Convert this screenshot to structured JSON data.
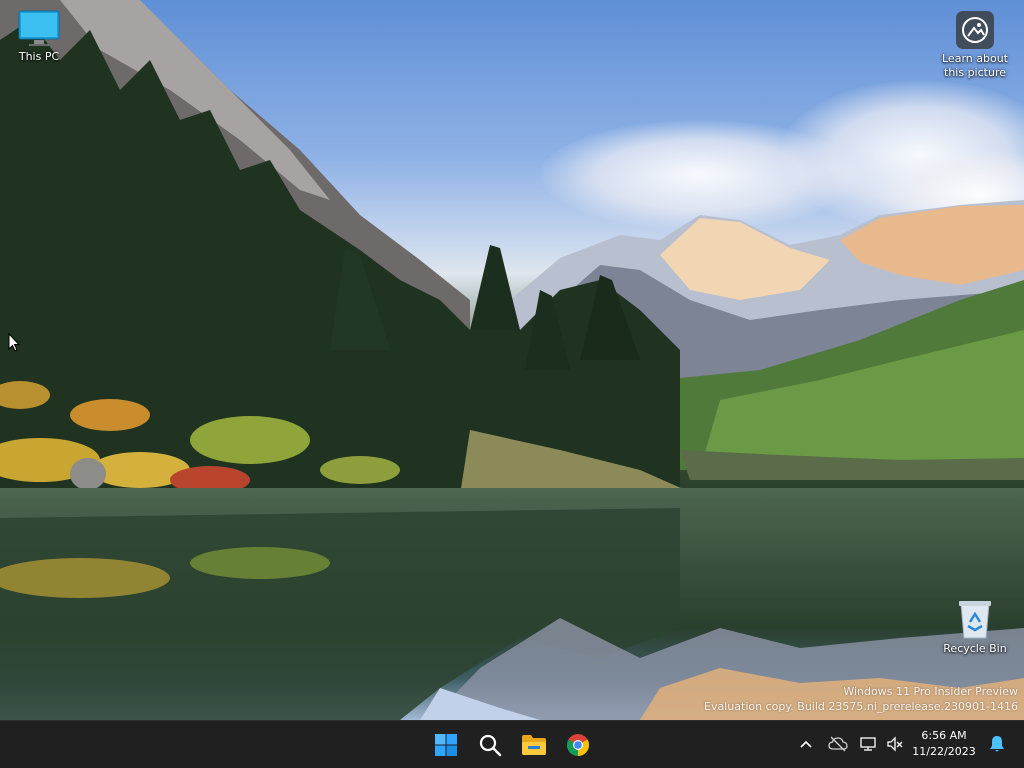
{
  "desktop": {
    "icons": [
      {
        "label": "This PC",
        "icon": "monitor-icon"
      },
      {
        "label": "Learn about this picture",
        "icon": "camera-icon"
      },
      {
        "label": "Recycle Bin",
        "icon": "recycle-bin-icon"
      }
    ],
    "watermark": {
      "line1": "Windows 11 Pro Insider Preview",
      "line2": "Evaluation copy. Build 23575.ni_prerelease.230901-1416"
    }
  },
  "taskbar": {
    "apps": [
      {
        "name": "Start",
        "icon": "windows-start-icon"
      },
      {
        "name": "Search",
        "icon": "search-icon"
      },
      {
        "name": "File Explorer",
        "icon": "folder-icon"
      },
      {
        "name": "Google Chrome",
        "icon": "chrome-icon"
      }
    ],
    "tray": {
      "icons": [
        "chevron-up-icon",
        "cloud-off-icon",
        "network-icon",
        "volume-mute-icon",
        "notification-bell-icon"
      ]
    },
    "clock": {
      "time": "6:56 AM",
      "date": "11/22/2023"
    }
  },
  "colors": {
    "taskbar_bg": "#202020",
    "accent_blue": "#0078d4",
    "chrome_red": "#db4437",
    "chrome_yellow": "#f4c20d",
    "chrome_green": "#0f9d58",
    "bell_blue": "#4cc2ff"
  }
}
